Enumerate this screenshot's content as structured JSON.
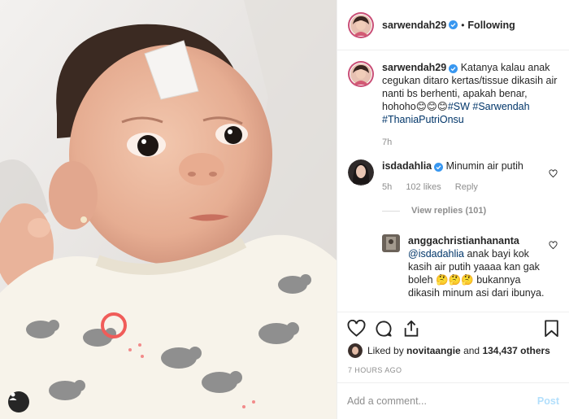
{
  "header": {
    "username": "sarwendah29",
    "separator": "•",
    "follow_status": "Following"
  },
  "caption": {
    "username": "sarwendah29",
    "text": "Katanya kalau anak cegukan ditaro kertas/tissue dikasih air nanti bs berhenti, apakah benar, hohoho😊😊😊",
    "tags": [
      "#SW",
      "#Sarwendah",
      "#ThaniaPutriOnsu"
    ],
    "age": "7h"
  },
  "comments": [
    {
      "username": "isdadahlia",
      "text": "Minumin air putih",
      "age": "5h",
      "likes": "102 likes",
      "reply": "Reply",
      "view_replies": "View replies (101)"
    },
    {
      "username": "anggachristianhananta",
      "mention": "@isdadahlia",
      "text": "anak bayi kok kasih air putih yaaaa kan gak boleh 🤔🤔🤔 bukannya dikasih minum asi dari ibunya."
    }
  ],
  "likes": {
    "prefix": "Liked by",
    "user": "novitaangie",
    "joiner": "and",
    "count": "134,437 others"
  },
  "timestamp": "7 HOURS AGO",
  "add_comment": {
    "placeholder": "Add a comment...",
    "post_label": "Post"
  },
  "colors": {
    "link": "#003569",
    "verified": "#3897f0",
    "post_disabled": "#b2dffc",
    "muted": "#8e8e8e"
  },
  "icons": {
    "photo_tag": "user-tag-icon",
    "like": "heart-icon",
    "comment": "comment-bubble-icon",
    "share": "share-icon",
    "save": "bookmark-icon",
    "verified": "verified-badge-icon"
  }
}
